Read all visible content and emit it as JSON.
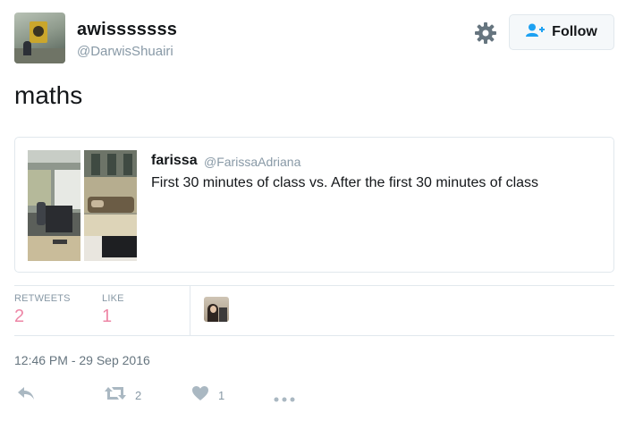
{
  "tweet": {
    "display_name": "awisssssss",
    "handle": "@DarwisShuairi",
    "text": "maths",
    "follow_label": "Follow",
    "timestamp": "12:46 PM - 29 Sep 2016"
  },
  "quoted": {
    "name": "farissa",
    "handle": "@FarissaAdriana",
    "text": "First 30 minutes of class vs. After the first 30 minutes of class"
  },
  "stats": {
    "retweets_label": "RETWEETS",
    "retweets_count": "2",
    "likes_label": "LIKE",
    "likes_count": "1"
  },
  "actions": {
    "retweet_count": "2",
    "like_count": "1"
  },
  "icons": [
    "gear-icon",
    "follow-person-plus-icon",
    "reply-icon",
    "retweet-icon",
    "like-heart-icon",
    "more-dots-icon"
  ],
  "colors": {
    "text": "#14171a",
    "muted": "#8899a6",
    "stat_pink": "#e0245e",
    "follow_blue": "#1da1f2",
    "border": "#e1e8ed"
  }
}
